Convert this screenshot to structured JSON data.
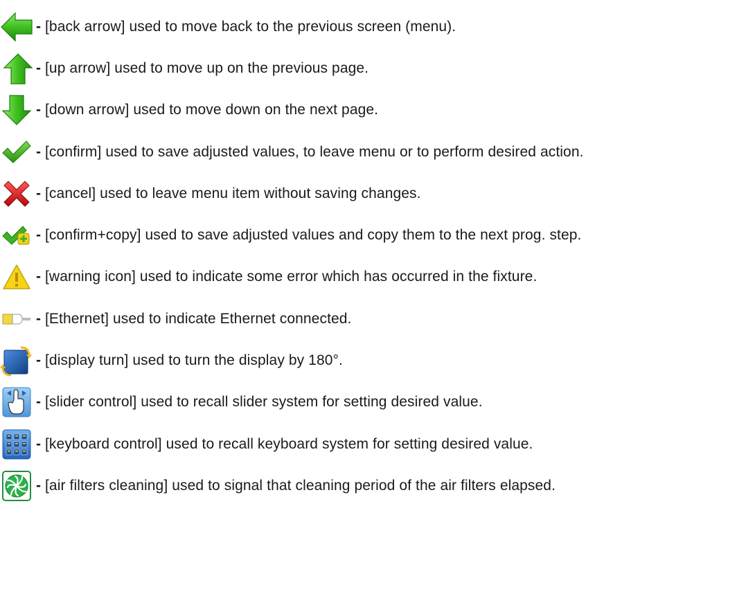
{
  "items": [
    {
      "icon": "back-arrow-icon",
      "dash": "-",
      "text": "[back arrow] used to move  back to the previous screen (menu)."
    },
    {
      "icon": "up-arrow-icon",
      "dash": "-",
      "text": "[up arrow] used to move up on the previous page."
    },
    {
      "icon": "down-arrow-icon",
      "dash": "-",
      "text": "[down arrow] used to move down on the next page."
    },
    {
      "icon": "confirm-check-icon",
      "dash": "-",
      "text": "[confirm] used to save adjusted values, to leave menu or to perform desired action."
    },
    {
      "icon": "cancel-x-icon",
      "dash": "-",
      "text": "[cancel] used to leave menu item without saving changes."
    },
    {
      "icon": "confirm-copy-icon",
      "dash": "-",
      "text": "[confirm+copy] used to save adjusted values and copy them to the next prog. step."
    },
    {
      "icon": "warning-icon",
      "dash": "-",
      "text": "[warning icon] used to indicate some error which has occurred in the fixture."
    },
    {
      "icon": "ethernet-icon",
      "dash": "-",
      "text": "[Ethernet] used to indicate Ethernet connected."
    },
    {
      "icon": "display-turn-icon",
      "dash": "-",
      "text": "[display turn] used to turn the display by 180°."
    },
    {
      "icon": "slider-control-icon",
      "dash": "-",
      "text": "[slider control] used to recall slider system for setting desired value."
    },
    {
      "icon": "keyboard-control-icon",
      "dash": "-",
      "text": "[keyboard control] used to recall keyboard system for setting desired value."
    },
    {
      "icon": "air-filters-icon",
      "dash": "-",
      "text": "[air filters cleaning] used to signal that cleaning period of the air filters elapsed."
    }
  ],
  "colors": {
    "arrow_green": "#3fbf1f",
    "arrow_green_dark": "#1f8a10",
    "check_green": "#3cb521",
    "cancel_red": "#d9191f",
    "warning_yellow": "#f7d417",
    "ethernet_yellow": "#f2d648",
    "blue_icon": "#2c6fbf",
    "fan_green": "#28b34a"
  }
}
